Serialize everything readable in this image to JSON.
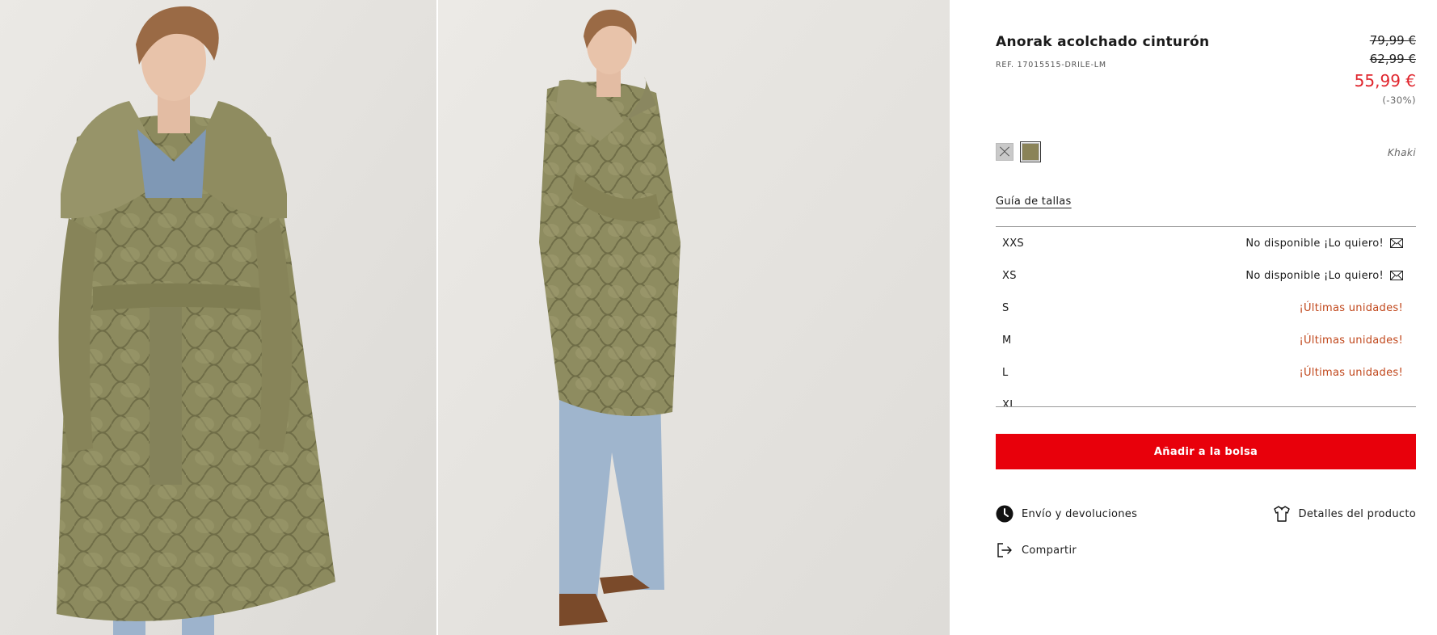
{
  "product": {
    "title": "Anorak acolchado cinturón",
    "ref": "REF. 17015515-DRILE-LM",
    "price_original_1": "79,99 €",
    "price_original_2": "62,99 €",
    "price_current": "55,99 €",
    "discount": "(-30%)",
    "color_name": "Khaki"
  },
  "colors": {
    "accent_red": "#e8000b",
    "price_red": "#e0262e",
    "low_stock": "#c0461a",
    "swatch_khaki": "#8a8358"
  },
  "swatches": [
    {
      "name": "swatch-unavailable",
      "state": "disabled"
    },
    {
      "name": "swatch-khaki",
      "state": "selected"
    }
  ],
  "size_guide_label": "Guía de tallas",
  "sizes": [
    {
      "label": "XXS",
      "status": "No disponible ¡Lo quiero!",
      "type": "unavailable",
      "icon": "mail-icon"
    },
    {
      "label": "XS",
      "status": "No disponible ¡Lo quiero!",
      "type": "unavailable",
      "icon": "mail-icon"
    },
    {
      "label": "S",
      "status": "¡Últimas unidades!",
      "type": "low"
    },
    {
      "label": "M",
      "status": "¡Últimas unidades!",
      "type": "low"
    },
    {
      "label": "L",
      "status": "¡Últimas unidades!",
      "type": "low"
    },
    {
      "label": "XL",
      "status": "",
      "type": "partial"
    }
  ],
  "add_button_label": "Añadir a la bolsa",
  "links": {
    "shipping": {
      "label": "Envío y devoluciones",
      "icon": "clock-icon"
    },
    "details": {
      "label": "Detalles del producto",
      "icon": "shirt-icon"
    },
    "share": {
      "label": "Compartir",
      "icon": "share-icon"
    }
  },
  "gallery": {
    "image1": "model-front-photo",
    "image2": "model-side-photo"
  }
}
